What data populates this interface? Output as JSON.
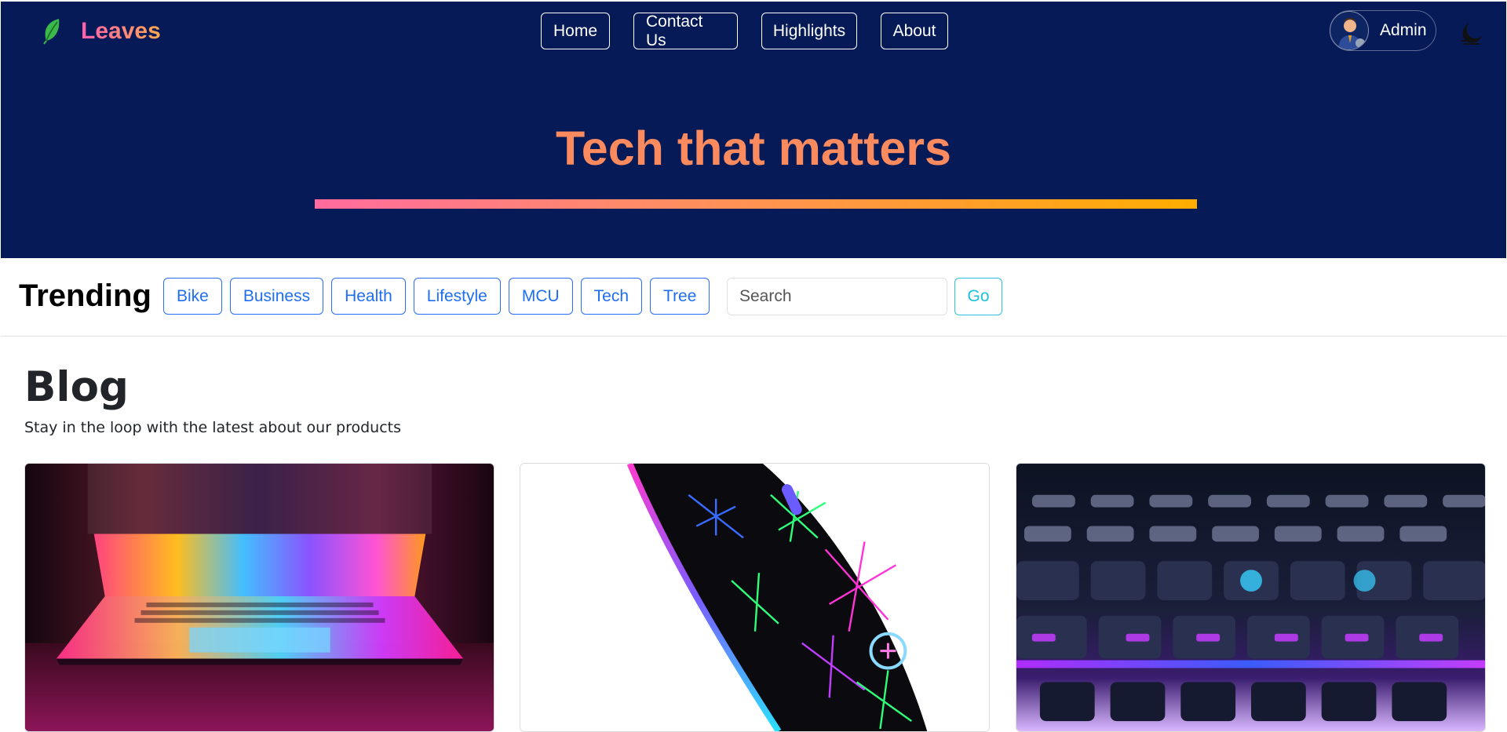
{
  "header": {
    "brand": "Leaves",
    "nav": [
      "Home",
      "Contact Us",
      "Highlights",
      "About"
    ],
    "user": "Admin",
    "icons": {
      "logo": "leaf-icon",
      "theme": "moon-icon",
      "avatar": "user-avatar"
    }
  },
  "hero": {
    "title": "Tech that matters"
  },
  "trending": {
    "title": "Trending",
    "tags": [
      "Bike",
      "Business",
      "Health",
      "Lifestyle",
      "MCU",
      "Tech",
      "Tree"
    ],
    "search_placeholder": "Search",
    "go_label": "Go"
  },
  "blog": {
    "title": "Blog",
    "subtitle": "Stay in the loop with the latest about our products"
  },
  "colors": {
    "hero_bg": "#061a58",
    "accent_pink": "#ff5fae",
    "accent_orange": "#ffa94d",
    "title_color": "#fb8a5e",
    "tag_blue": "#1f6ef2",
    "go_cyan": "#1cbfdc"
  }
}
